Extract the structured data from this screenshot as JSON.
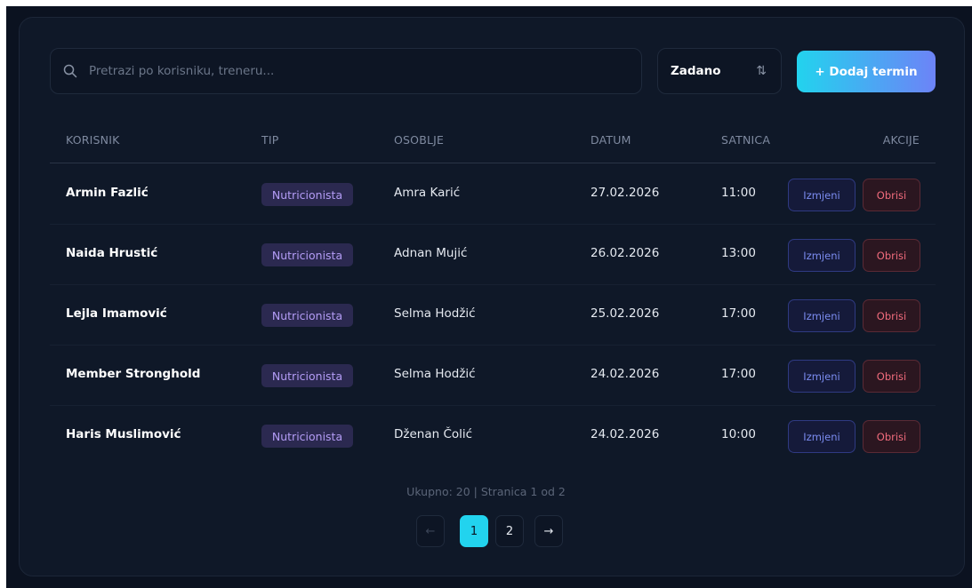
{
  "toolbar": {
    "search_placeholder": "Pretrazi po korisniku, treneru...",
    "sort_label": "Zadano",
    "sort_icon": "sort-arrows-icon",
    "add_label": "+ Dodaj termin"
  },
  "table": {
    "columns": [
      "KORISNIK",
      "TIP",
      "OSOBLJE",
      "DATUM",
      "SATNICA",
      "AKCIJE"
    ],
    "rows": [
      {
        "korisnik": "Armin Fazlić",
        "tip": "Nutricionista",
        "osoblje": "Amra Karić",
        "datum": "27.02.2026",
        "satnica": "11:00",
        "edit": "Izmjeni",
        "delete": "Obrisi"
      },
      {
        "korisnik": "Naida Hrustić",
        "tip": "Nutricionista",
        "osoblje": "Adnan Mujić",
        "datum": "26.02.2026",
        "satnica": "13:00",
        "edit": "Izmjeni",
        "delete": "Obrisi"
      },
      {
        "korisnik": "Lejla Imamović",
        "tip": "Nutricionista",
        "osoblje": "Selma Hodžić",
        "datum": "25.02.2026",
        "satnica": "17:00",
        "edit": "Izmjeni",
        "delete": "Obrisi"
      },
      {
        "korisnik": "Member Stronghold",
        "tip": "Nutricionista",
        "osoblje": "Selma Hodžić",
        "datum": "24.02.2026",
        "satnica": "17:00",
        "edit": "Izmjeni",
        "delete": "Obrisi"
      },
      {
        "korisnik": "Haris Muslimović",
        "tip": "Nutricionista",
        "osoblje": "Dženan Čolić",
        "datum": "24.02.2026",
        "satnica": "10:00",
        "edit": "Izmjeni",
        "delete": "Obrisi"
      }
    ]
  },
  "pagination": {
    "summary": "Ukupno: 20 | Stranica 1 od 2",
    "prev_icon": "arrow-left-icon",
    "pages": [
      "1",
      "2"
    ],
    "current_page": "1",
    "next_icon": "arrow-right-icon"
  },
  "colors": {
    "background": "#0b1220",
    "card": "#0f1828",
    "accent_cyan": "#22d3ee",
    "accent_indigo": "#6d83f7",
    "badge_text": "#b39cf5",
    "delete_text": "#f06b7c"
  }
}
